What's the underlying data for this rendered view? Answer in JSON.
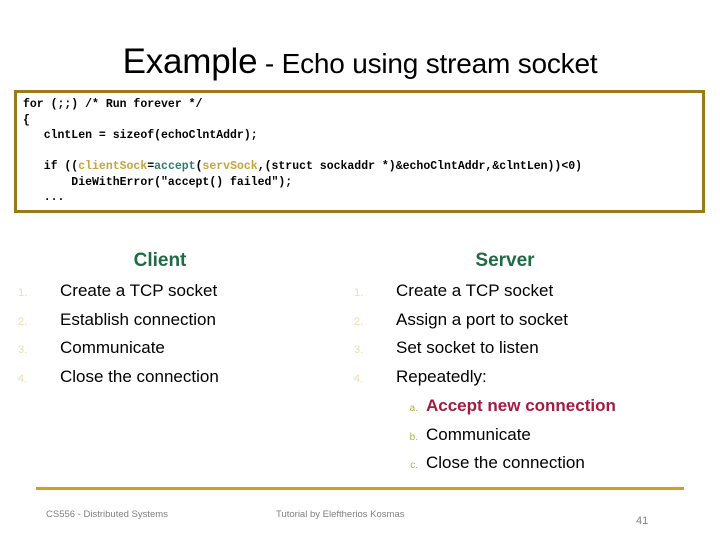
{
  "slide": {
    "title_main": "Example",
    "title_rest": " - Echo using stream socket"
  },
  "code_block": {
    "language": "c",
    "lines": [
      "for (;;) /* Run forever */",
      "{",
      "   clntLen = sizeof(echoClntAddr);",
      "",
      "   if ((clientSock=accept(servSock,(struct sockaddr *)&echoClntAddr,&clntLen))<0)",
      "       DieWithError(\"accept() failed\");",
      "   ..."
    ],
    "tokens": {
      "variable_1": "clientSock",
      "function_1": "accept",
      "variable_2": "servSock"
    },
    "border_color": "#9a7b18",
    "variable_color": "#c7a33a",
    "function_color": "#2e7d6a"
  },
  "columns": {
    "client": {
      "heading": "Client",
      "heading_color": "#1f6b45",
      "steps": [
        {
          "num": "1.",
          "text": "Create a TCP socket"
        },
        {
          "num": "2.",
          "text": "Establish connection"
        },
        {
          "num": "3.",
          "text": "Communicate"
        },
        {
          "num": "4.",
          "text": "Close the connection"
        }
      ]
    },
    "server": {
      "heading": "Server",
      "heading_color": "#1f6b45",
      "steps": [
        {
          "num": "1.",
          "text": "Create a TCP socket"
        },
        {
          "num": "2.",
          "text": "Assign a port to socket"
        },
        {
          "num": "3.",
          "text": "Set socket to listen"
        },
        {
          "num": "4.",
          "text": "Repeatedly:"
        }
      ],
      "substeps": [
        {
          "num": "a.",
          "text": "Accept new connection",
          "highlight": true
        },
        {
          "num": "b.",
          "text": "Communicate",
          "highlight": false
        },
        {
          "num": "c.",
          "text": "Close the connection",
          "highlight": false
        }
      ],
      "highlight_color": "#a61a42"
    }
  },
  "footer": {
    "left": "CS556 - Distributed Systems",
    "center": "Tutorial by Eleftherios Kosmas",
    "page_number": "41",
    "rule_color": "#c9a227"
  }
}
